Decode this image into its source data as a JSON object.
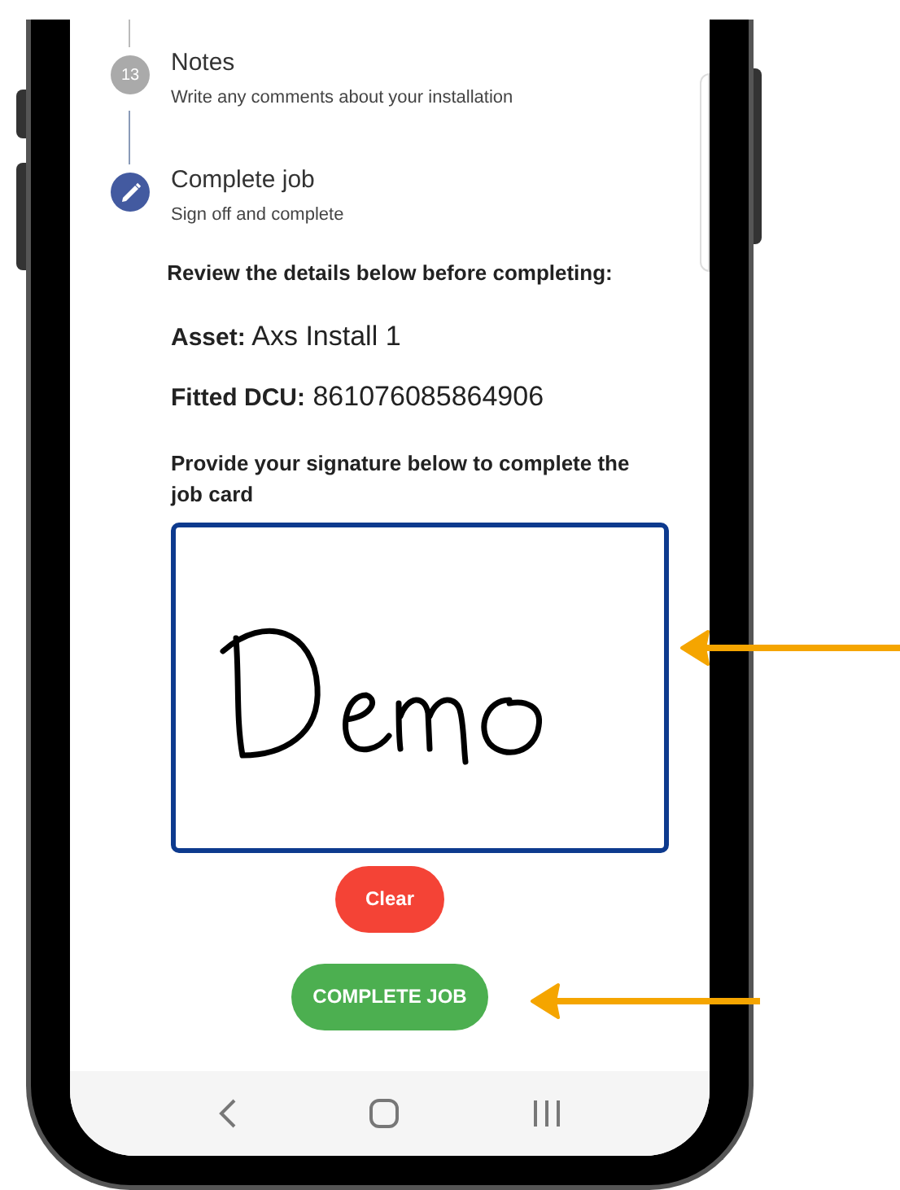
{
  "steps": [
    {
      "kind": "number",
      "number": "13",
      "title": "Notes",
      "subtitle": "Write any comments about your installation"
    },
    {
      "kind": "edit",
      "title": "Complete job",
      "subtitle": "Sign off and complete"
    }
  ],
  "review": {
    "heading": "Review the details below before completing:",
    "details": [
      {
        "label": "Asset:",
        "value": "Axs Install 1"
      },
      {
        "label": "Fitted DCU:",
        "value": "861076085864906"
      }
    ],
    "signature_prompt": "Provide your signature below to complete the job card"
  },
  "buttons": [
    {
      "kind": "clear",
      "label": "Clear"
    },
    {
      "kind": "complete",
      "label": "COMPLETE JOB"
    }
  ]
}
